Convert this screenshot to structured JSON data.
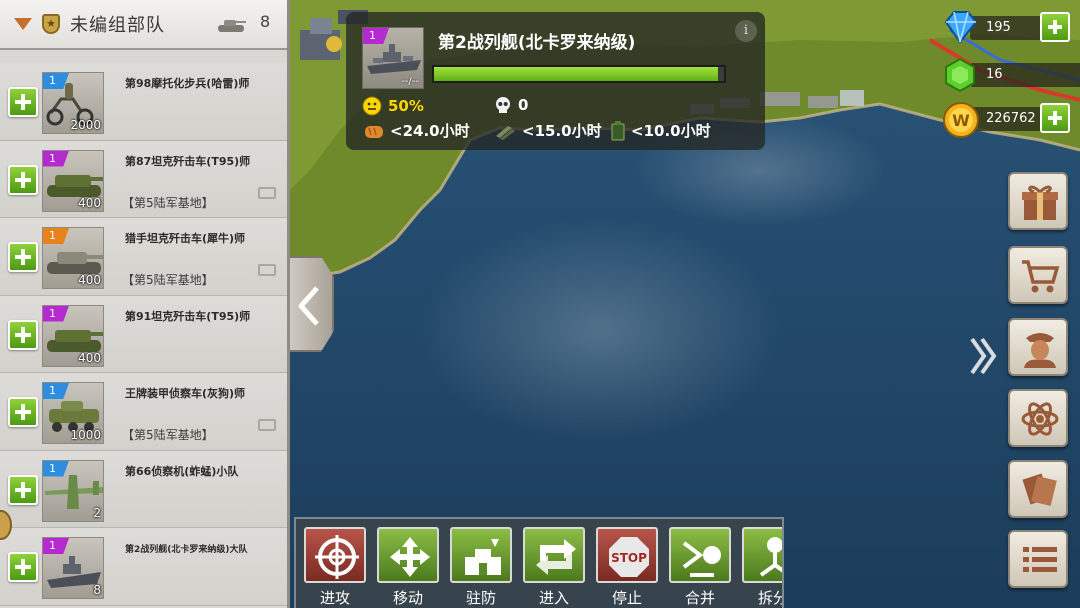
{
  "unit_panel": {
    "title": "未编组部队",
    "count": "8",
    "units": [
      {
        "level": "1",
        "level_color": "blue",
        "name": "第98摩托化步兵(哈雷)师",
        "strength": "2000",
        "base": ""
      },
      {
        "level": "1",
        "level_color": "purple",
        "name": "第87坦克歼击车(T95)师",
        "strength": "400",
        "base": "【第5陆军基地】"
      },
      {
        "level": "1",
        "level_color": "orange",
        "name": "猎手坦克歼击车(犀牛)师",
        "strength": "400",
        "base": "【第5陆军基地】"
      },
      {
        "level": "1",
        "level_color": "purple",
        "name": "第91坦克歼击车(T95)师",
        "strength": "400",
        "base": ""
      },
      {
        "level": "1",
        "level_color": "blue",
        "name": "王牌装甲侦察车(灰狗)师",
        "strength": "1000",
        "base": "【第5陆军基地】"
      },
      {
        "level": "1",
        "level_color": "blue",
        "name": "第66侦察机(蚱蜢)小队",
        "strength": "2",
        "base": ""
      },
      {
        "level": "1",
        "level_color": "purple",
        "name": "第2战列舰(北卡罗来纳级)大队",
        "strength": "8",
        "base": ""
      }
    ]
  },
  "unit_info": {
    "level": "1",
    "title": "第2战列舰(北卡罗来纳级)",
    "hp_text": "--/--",
    "hp_fraction": 0.98,
    "morale": "50%",
    "kills": "0",
    "food": "<24.0小时",
    "ammo": "<15.0小时",
    "fuel": "<10.0小时",
    "info_icon": "i"
  },
  "resources": {
    "diamonds": "195",
    "gems": "16",
    "gold": "226762"
  },
  "side_menu": [
    "gift-icon",
    "cart-icon",
    "officer-icon",
    "research-icon",
    "cards-icon",
    "list-icon"
  ],
  "actions": [
    {
      "label": "进攻",
      "icon": "target-icon",
      "style": "red"
    },
    {
      "label": "移动",
      "icon": "move-arrows-icon",
      "style": "green"
    },
    {
      "label": "驻防",
      "icon": "fortify-icon",
      "style": "green"
    },
    {
      "label": "进入",
      "icon": "enter-icon",
      "style": "green"
    },
    {
      "label": "停止",
      "icon": "stop-sign-icon",
      "style": "red"
    },
    {
      "label": "合并",
      "icon": "merge-icon",
      "style": "green"
    },
    {
      "label": "拆分",
      "icon": "split-icon",
      "style": "green"
    }
  ],
  "colors": {
    "level_blue": "#2d8ee0",
    "level_purple": "#b42ad0",
    "level_orange": "#e8821c",
    "accent_green": "#6cc220",
    "morale_yellow": "#ffd500"
  }
}
